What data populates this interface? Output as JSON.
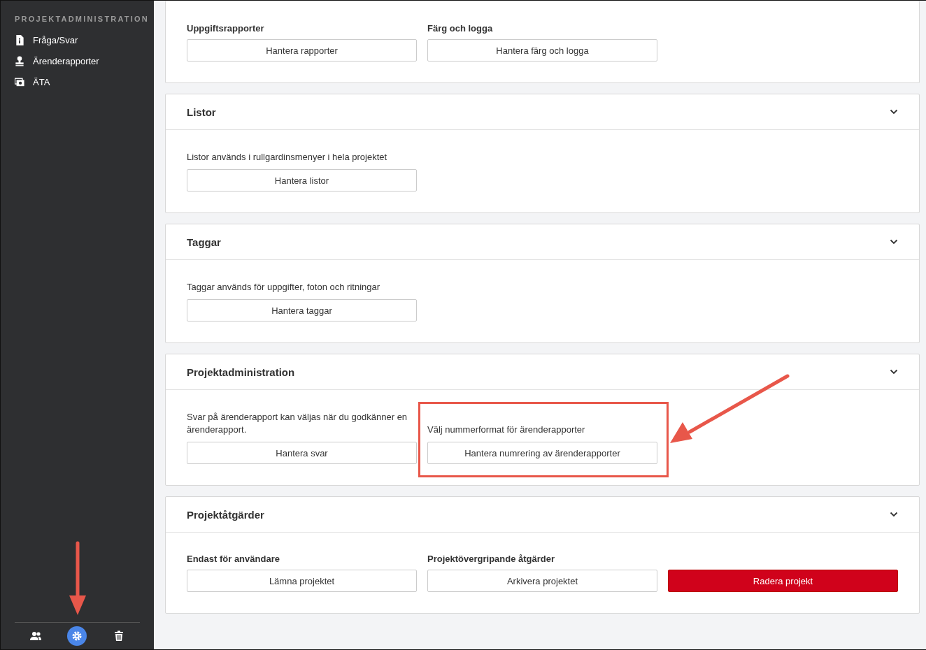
{
  "sidebar": {
    "heading": "PROJEKTADMINISTRATION",
    "items": [
      {
        "kind": "document",
        "label": "Fråga/Svar"
      },
      {
        "kind": "stamp",
        "label": "Ärenderapporter"
      },
      {
        "kind": "photos",
        "label": "ÄTA"
      }
    ],
    "footer": [
      {
        "kind": "people",
        "selected": false
      },
      {
        "kind": "gear",
        "selected": true
      },
      {
        "kind": "trash",
        "selected": false
      }
    ]
  },
  "sections": [
    {
      "columns": [
        {
          "label": "Uppgiftsrapporter",
          "button": {
            "label": "Hantera rapporter",
            "kind": "normal"
          },
          "highlighted": false
        },
        {
          "label": "Färg och logga",
          "button": {
            "label": "Hantera färg och logga",
            "kind": "normal"
          },
          "highlighted": false
        }
      ]
    },
    {
      "title": "Listor",
      "columns": [
        {
          "description": "Listor används i rullgardinsmenyer i hela projektet",
          "button": {
            "label": "Hantera listor",
            "kind": "normal"
          },
          "highlighted": false
        }
      ]
    },
    {
      "title": "Taggar",
      "columns": [
        {
          "description": "Taggar används för uppgifter, foton och ritningar",
          "button": {
            "label": "Hantera taggar",
            "kind": "normal"
          },
          "highlighted": false
        }
      ]
    },
    {
      "title": "Projektadministration",
      "columns": [
        {
          "description": "Svar på ärenderapport kan väljas när du godkänner en ärenderapport.",
          "button": {
            "label": "Hantera svar",
            "kind": "normal"
          },
          "highlighted": false
        },
        {
          "description": "Välj nummerformat för ärenderapporter",
          "button": {
            "label": "Hantera numrering av ärenderapporter",
            "kind": "normal"
          },
          "highlighted": true
        }
      ]
    },
    {
      "title": "Projektåtgärder",
      "columns": [
        {
          "label": "Endast för användare",
          "button": {
            "label": "Lämna projektet",
            "kind": "normal"
          },
          "highlighted": false
        },
        {
          "label": "Projektövergripande åtgärder",
          "button": {
            "label": "Arkivera projektet",
            "kind": "normal"
          },
          "highlighted": false
        },
        {
          "button": {
            "label": "Radera projekt",
            "kind": "danger"
          },
          "highlighted": false
        }
      ]
    }
  ]
}
